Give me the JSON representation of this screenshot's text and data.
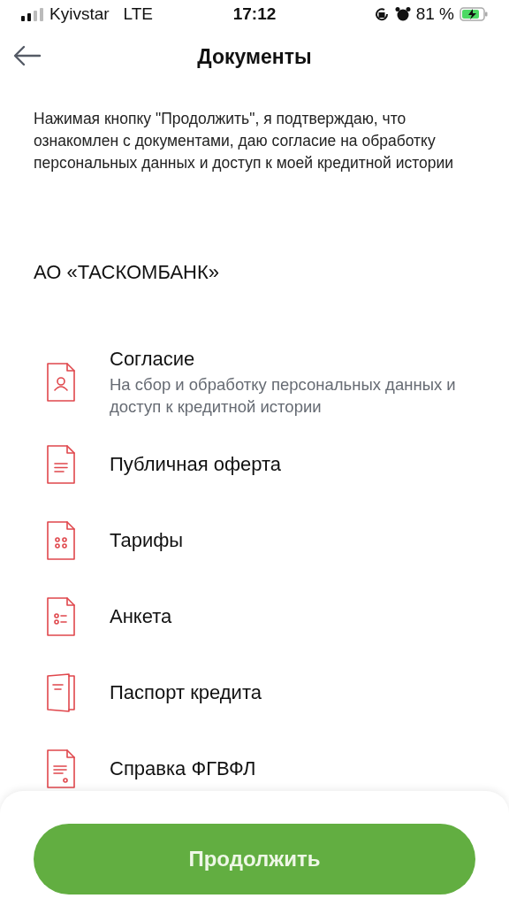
{
  "status_bar": {
    "carrier": "Kyivstar",
    "network": "LTE",
    "time": "17:12",
    "battery": "81 %"
  },
  "header": {
    "title": "Документы"
  },
  "notice": "Нажимая кнопку \"Продолжить\", я подтверждаю, что ознакомлен с документами, даю согласие на обработку персональных данных и доступ к моей кредитной истории",
  "section_title": "АО «ТАСКОМБАНК»",
  "documents": [
    {
      "kind": "person",
      "title": "Согласие",
      "subtitle": "На сбор и обработку персональных данных и доступ к кредитной истории"
    },
    {
      "kind": "text",
      "title": "Публичная оферта"
    },
    {
      "kind": "grid",
      "title": "Тарифы"
    },
    {
      "kind": "list",
      "title": "Анкета"
    },
    {
      "kind": "booklet",
      "title": "Паспорт кредита"
    },
    {
      "kind": "stamp",
      "title": "Справка ФГВФЛ"
    }
  ],
  "primary_button": "Продолжить"
}
